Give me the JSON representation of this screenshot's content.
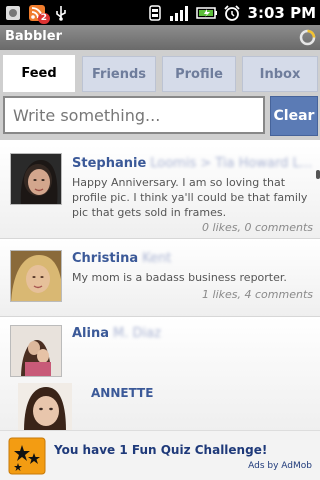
{
  "status_bar": {
    "time": "3:03 PM",
    "notification_count": "2",
    "icons": [
      "app-notification-icon",
      "rss-icon",
      "usb-icon",
      "sync-icon",
      "signal-icon",
      "battery-icon",
      "alarm-icon"
    ]
  },
  "app": {
    "title": "Babbler"
  },
  "tabs": [
    {
      "label": "Feed",
      "active": true
    },
    {
      "label": "Friends",
      "active": false
    },
    {
      "label": "Profile",
      "active": false
    },
    {
      "label": "Inbox",
      "active": false
    }
  ],
  "compose": {
    "placeholder": "Write something...",
    "clear_label": "Clear"
  },
  "feed": {
    "posts": [
      {
        "author": "Stephanie",
        "author_rest": "Loomis > Tia Howard L...",
        "text": "Happy Anniversary. I am so loving that profile pic. I think ya'll could be that family pic that gets sold in frames.",
        "meta": "0 likes, 0 comments"
      },
      {
        "author": "Christina",
        "author_rest": "Kent",
        "text": "My mom is a badass business reporter.",
        "meta": "1 likes, 4 comments"
      },
      {
        "author": "Alina",
        "author_rest": "M. Diaz",
        "text": "",
        "meta": "",
        "photo_caption": "ANNETTE"
      }
    ]
  },
  "ad": {
    "text": "You have 1 Fun Quiz Challenge!",
    "by": "Ads by AdMob"
  },
  "colors": {
    "accent": "#3b5998",
    "tab_inactive_text": "#6f7d9c",
    "clear_button": "#5b7bb5",
    "ad_icon": "#f39c12"
  }
}
